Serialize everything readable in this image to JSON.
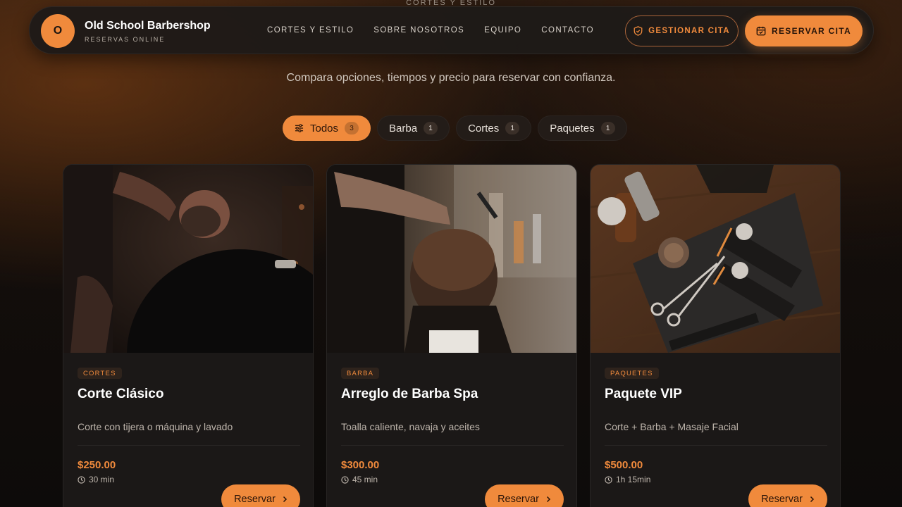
{
  "hero": {
    "eyebrow": "CORTES Y ESTILO",
    "subtitle": "Compara opciones, tiempos y precio para reservar con confianza."
  },
  "brand": {
    "initial": "O",
    "name": "Old School Barbershop",
    "tagline": "RESERVAS ONLINE"
  },
  "nav": {
    "links": [
      "CORTES Y ESTILO",
      "SOBRE NOSOTROS",
      "EQUIPO",
      "CONTACTO"
    ],
    "manage_label": "GESTIONAR CITA",
    "book_label": "RESERVAR CITA"
  },
  "filters": [
    {
      "label": "Todos",
      "count": "3",
      "active": true
    },
    {
      "label": "Barba",
      "count": "1",
      "active": false
    },
    {
      "label": "Cortes",
      "count": "1",
      "active": false
    },
    {
      "label": "Paquetes",
      "count": "1",
      "active": false
    }
  ],
  "cards": [
    {
      "category": "CORTES",
      "title": "Corte Clásico",
      "description": "Corte con tijera o máquina y lavado",
      "price": "$250.00",
      "duration": "30 min",
      "button": "Reservar"
    },
    {
      "category": "BARBA",
      "title": "Arreglo de Barba Spa",
      "description": "Toalla caliente, navaja y aceites",
      "price": "$300.00",
      "duration": "45 min",
      "button": "Reservar"
    },
    {
      "category": "PAQUETES",
      "title": "Paquete VIP",
      "description": "Corte + Barba + Masaje Facial",
      "price": "$500.00",
      "duration": "1h 15min",
      "button": "Reservar"
    }
  ],
  "colors": {
    "accent": "#f08a3c",
    "background": "#0d0b0a",
    "card": "#1b1817"
  }
}
